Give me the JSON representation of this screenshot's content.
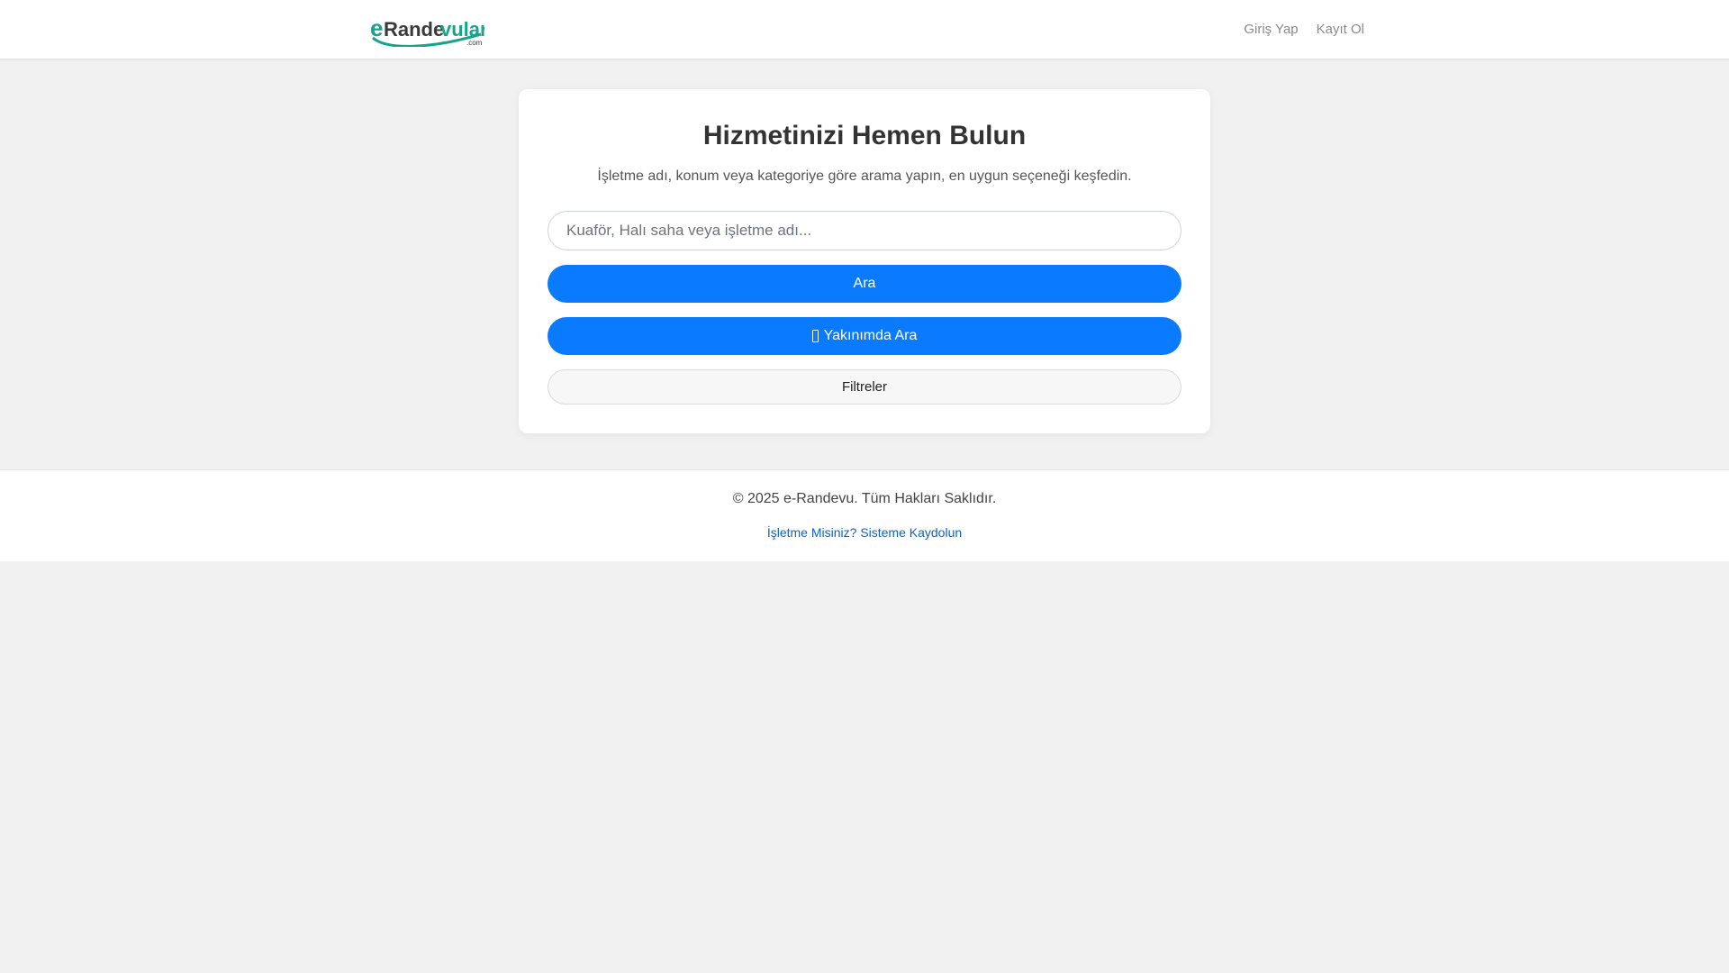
{
  "header": {
    "logo_text": "eRandevular",
    "logo_suffix": ".com",
    "links": [
      {
        "label": "Giriş Yap"
      },
      {
        "label": "Kayıt Ol"
      }
    ]
  },
  "search_card": {
    "title": "Hizmetinizi Hemen Bulun",
    "subtitle": "İşletme adı, konum veya kategoriye göre arama yapın, en uygun seçeneği keşfedin.",
    "input": {
      "placeholder": "Kuaför, Halı saha veya işletme adı...",
      "value": ""
    },
    "search_button": "Ara",
    "nearby_button": "Yakınımda Ara",
    "filters_button": "Filtreler"
  },
  "footer": {
    "copyright": "© 2025 e-Randevu. Tüm Hakları Saklıdır.",
    "business_link": "İşletme Misiniz? Sisteme Kaydolun"
  },
  "colors": {
    "primary": "#0a7bff",
    "logo_teal": "#1aa38c",
    "logo_dark": "#3a3a3a",
    "link": "#0b63c9",
    "page_bg": "#f1f1f1"
  }
}
